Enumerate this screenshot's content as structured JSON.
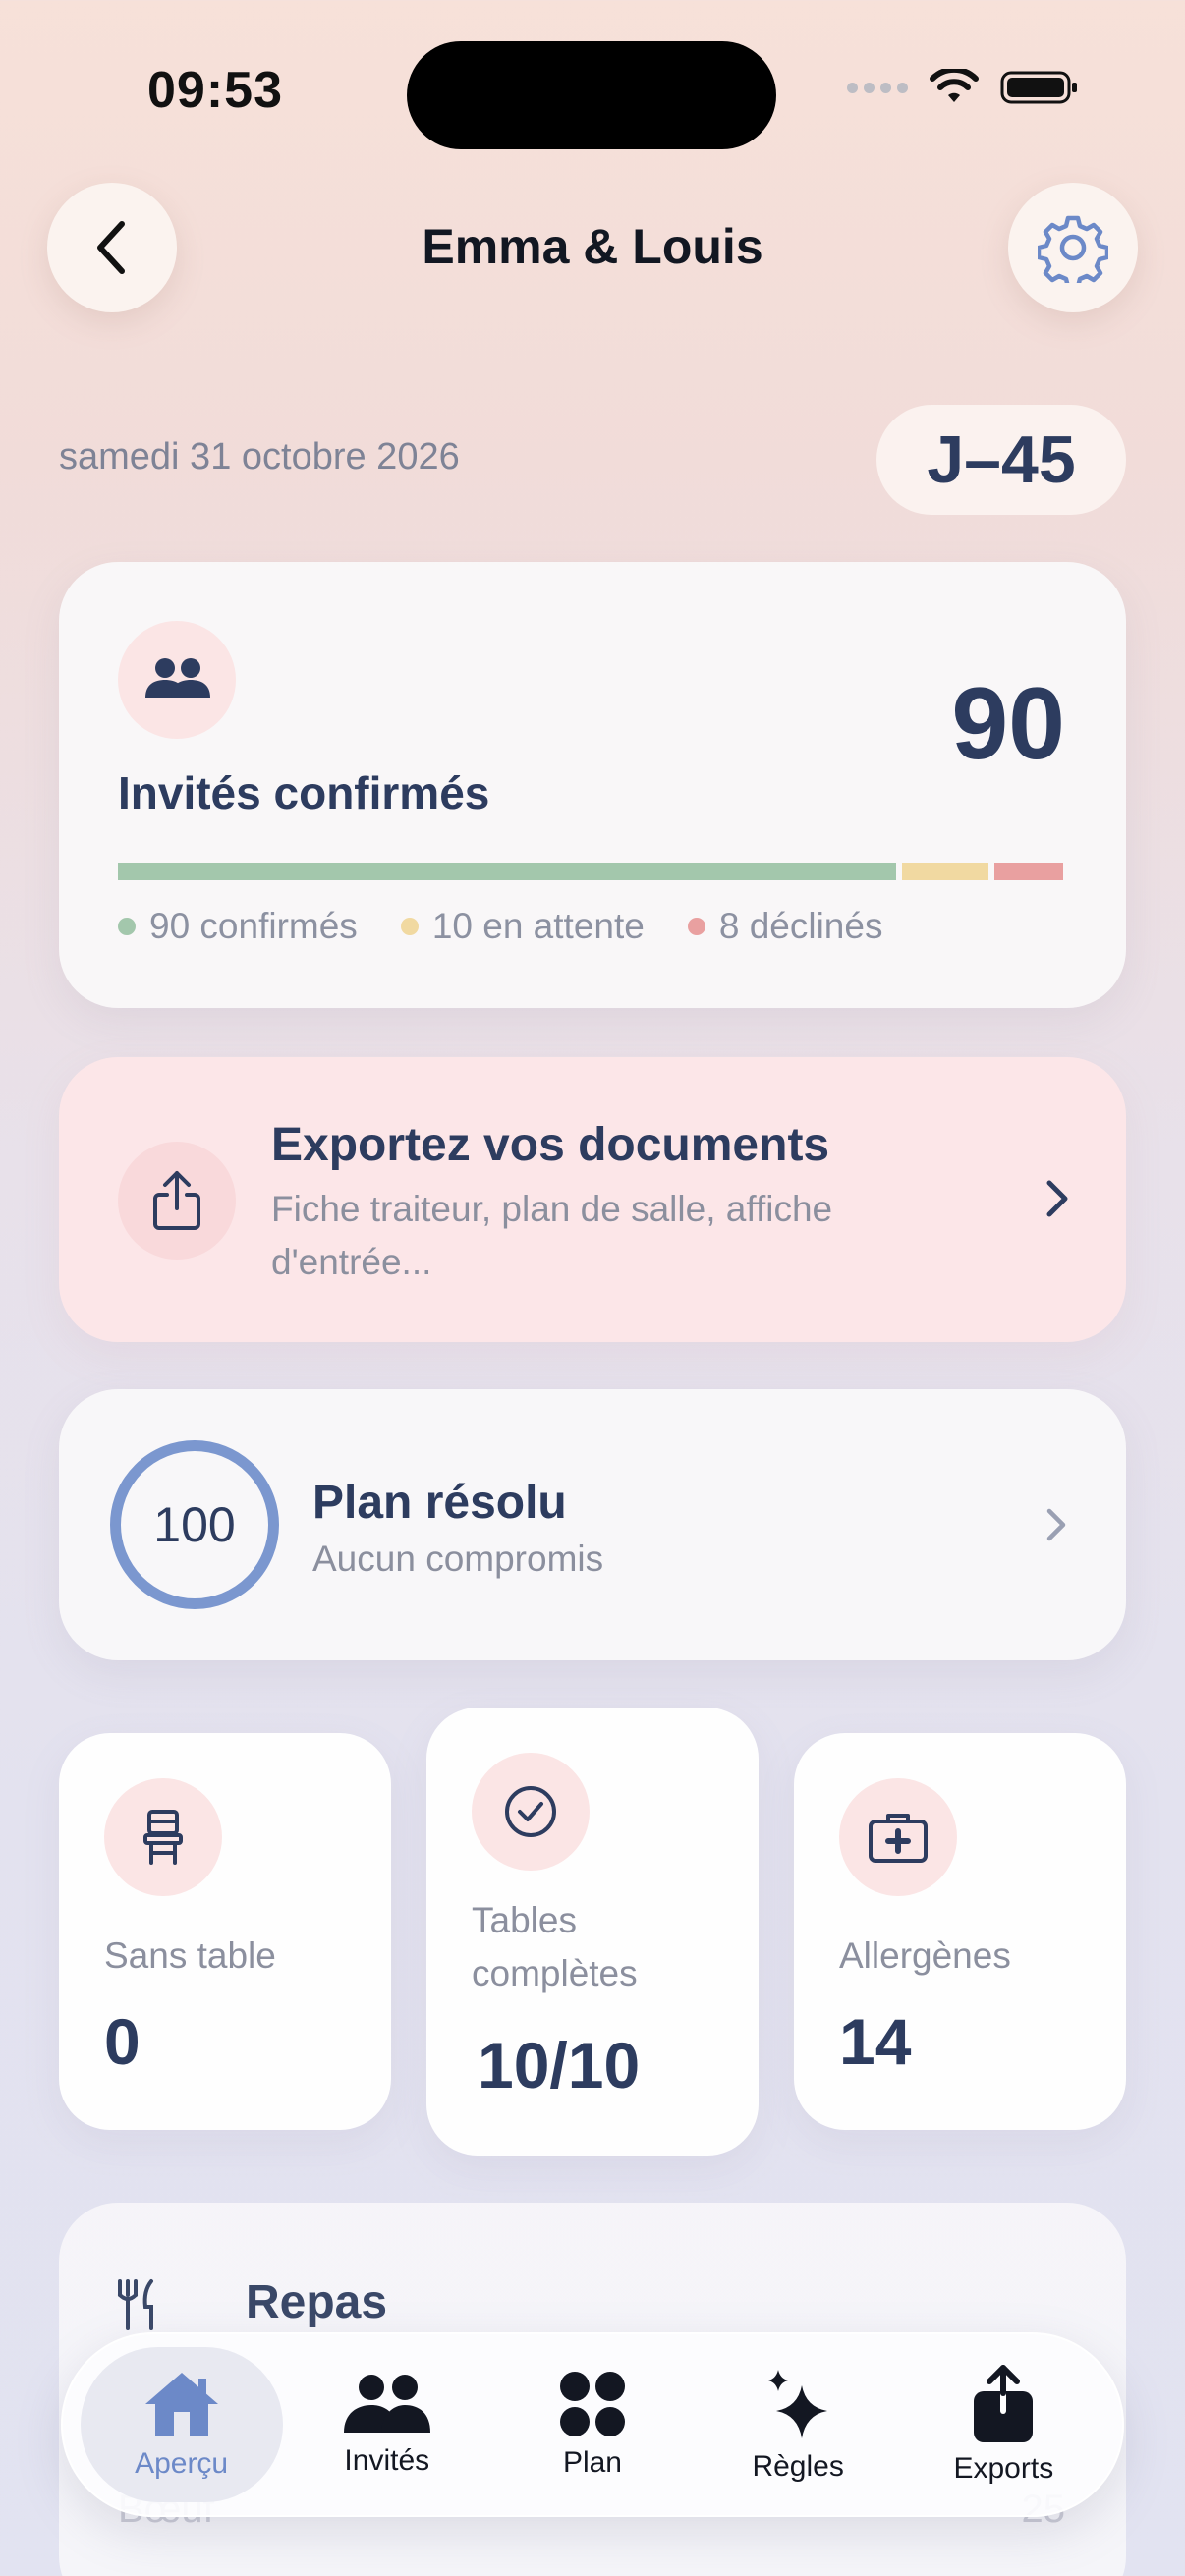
{
  "status_bar": {
    "time": "09:53"
  },
  "header": {
    "title": "Emma & Louis",
    "back_icon": "chevron-left-icon",
    "settings_icon": "gear-icon"
  },
  "event": {
    "date": "samedi 31 octobre 2026",
    "countdown": "J–45"
  },
  "guests": {
    "count": "90",
    "title": "Invités confirmés",
    "confirmed": 90,
    "pending": 10,
    "declined": 8,
    "legend": [
      "90 confirmés",
      "10 en attente",
      "8 déclinés"
    ],
    "colors": {
      "confirmed": "#a3c7ac",
      "pending": "#f1d9a1",
      "declined": "#e9a0a0"
    }
  },
  "export": {
    "title": "Exportez vos documents",
    "subtitle": "Fiche traiteur, plan de salle, affiche d'entrée..."
  },
  "plan": {
    "score": "100",
    "title": "Plan résolu",
    "subtitle": "Aucun compromis"
  },
  "stats": [
    {
      "label": "Sans table",
      "value": "0",
      "icon": "chair-icon"
    },
    {
      "label": "Tables complètes",
      "value": "10/10",
      "icon": "check-circle-icon"
    },
    {
      "label": "Allergènes",
      "value": "14",
      "icon": "first-aid-kit-icon"
    }
  ],
  "meals": {
    "title": "Repas",
    "row_label": "Bœuf",
    "row_value": "25"
  },
  "tabs": [
    {
      "label": "Aperçu",
      "icon": "home-icon",
      "active": true
    },
    {
      "label": "Invités",
      "icon": "people-icon",
      "active": false
    },
    {
      "label": "Plan",
      "icon": "grid-dots-icon",
      "active": false
    },
    {
      "label": "Règles",
      "icon": "sparkles-icon",
      "active": false
    },
    {
      "label": "Exports",
      "icon": "share-icon",
      "active": false
    }
  ],
  "accent": "#6c89c8"
}
